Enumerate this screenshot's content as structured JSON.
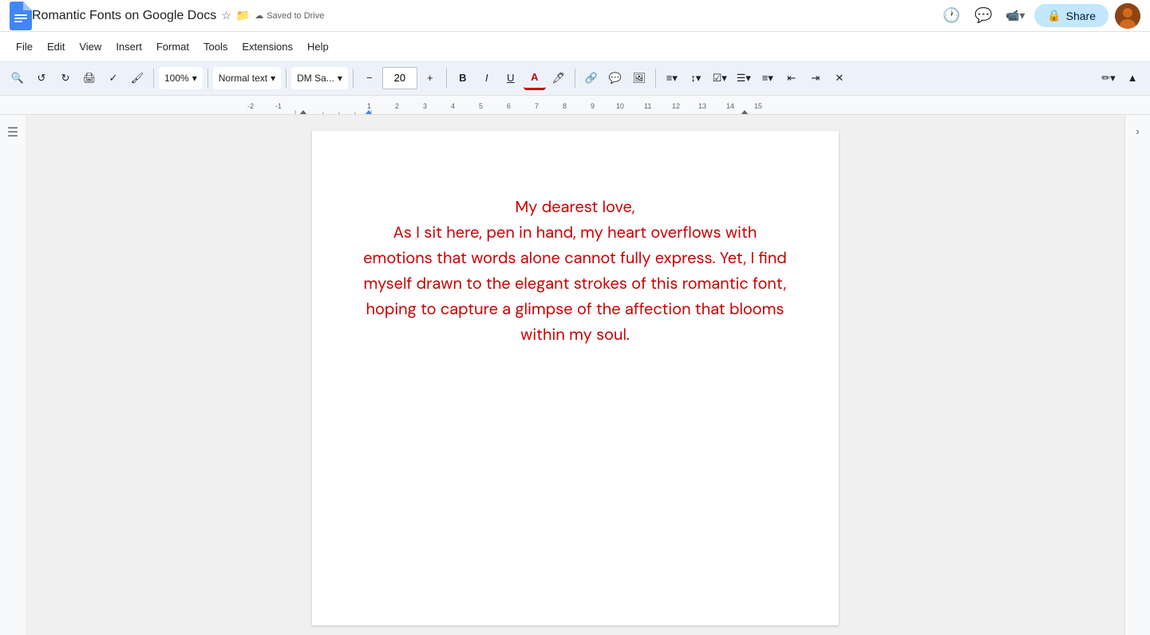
{
  "titleBar": {
    "title": "Romantic Fonts on Google Docs",
    "cloudStatus": "Saved to Drive",
    "shareLabel": "Share"
  },
  "menuBar": {
    "items": [
      "File",
      "Edit",
      "View",
      "Insert",
      "Format",
      "Tools",
      "Extensions",
      "Help"
    ]
  },
  "toolbar": {
    "zoom": "100%",
    "textStyle": "Normal text",
    "fontFamily": "DM Sa...",
    "fontSize": "20",
    "boldLabel": "B",
    "italicLabel": "I",
    "underlineLabel": "U"
  },
  "document": {
    "content": "My dearest love,\nAs I sit here, pen in hand, my heart overflows with emotions that words alone cannot fully express. Yet, I find myself drawn to the elegant strokes of this romantic font, hoping to capture a glimpse of the affection that blooms within my soul."
  },
  "icons": {
    "undo": "↺",
    "redo": "↻",
    "print": "🖨",
    "spellcheck": "✓",
    "paintFormat": "🖌",
    "minus": "−",
    "plus": "+",
    "link": "🔗",
    "comment": "💬",
    "image": "🖼",
    "align": "≡",
    "list": "☰",
    "indent": "→",
    "outdent": "←",
    "clear": "✕",
    "pencil": "✏",
    "collapse": "▲",
    "search": "🔍",
    "history": "🕐",
    "chat": "💬",
    "video": "📹",
    "lock": "🔒",
    "chevronDown": "▾",
    "hamburger": "☰",
    "sidebarToggle": "☰",
    "rightCollapse": "›"
  }
}
